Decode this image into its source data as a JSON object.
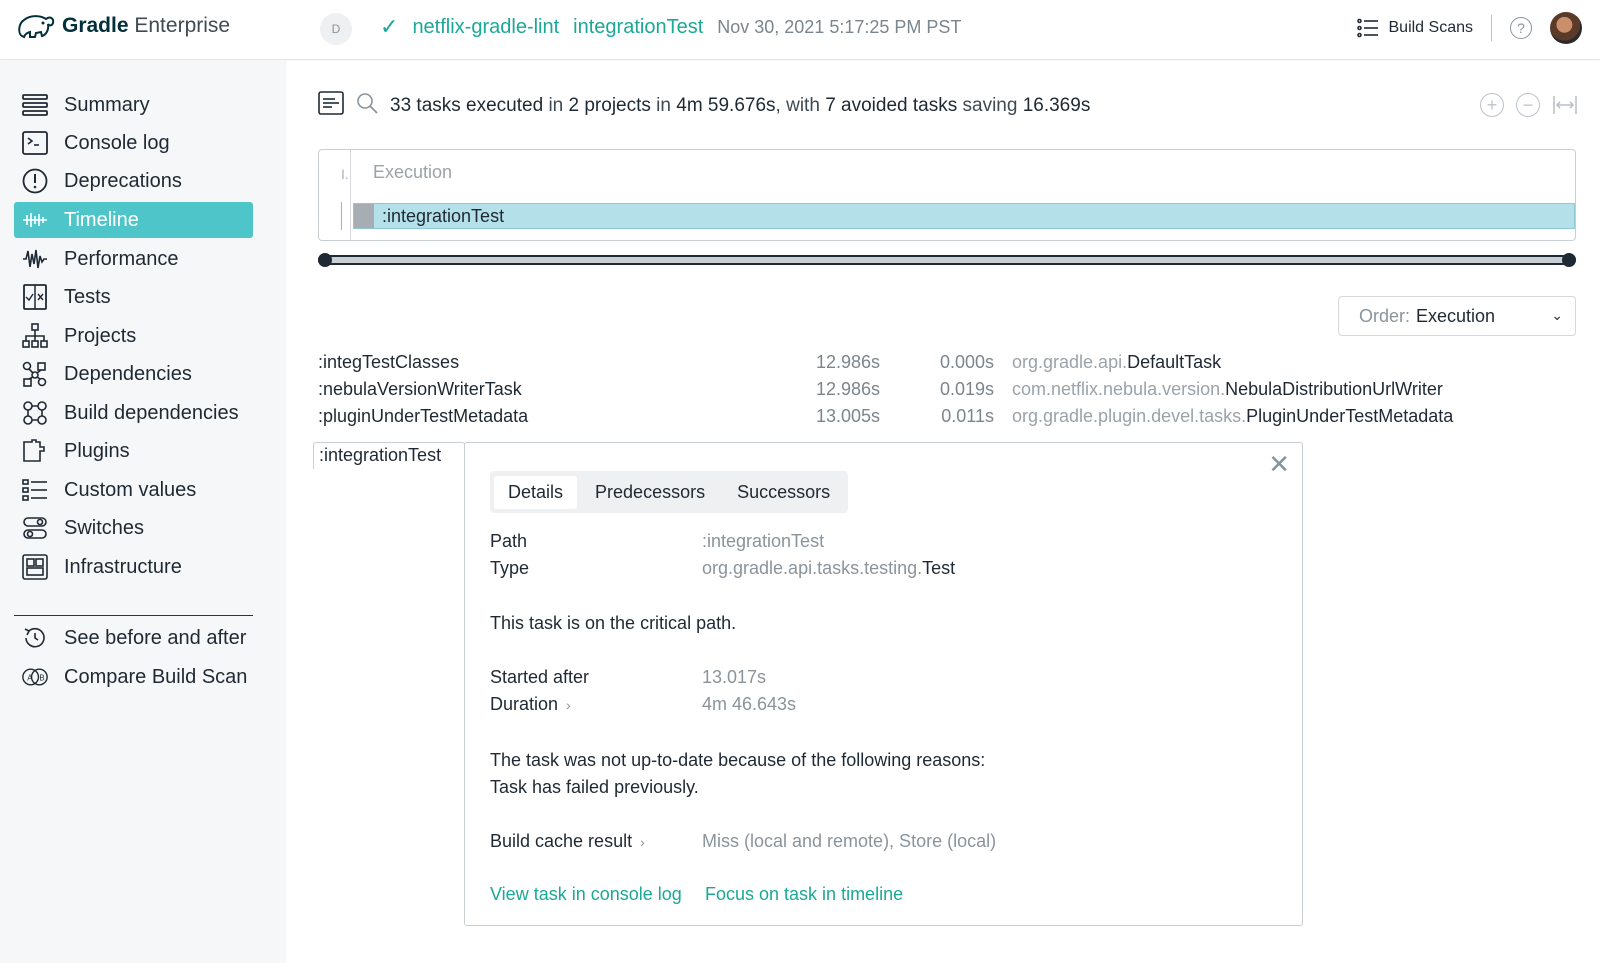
{
  "header": {
    "logo_bold": "Gradle",
    "logo_light": "Enterprise",
    "user_initial": "D",
    "project": "netflix-gradle-lint",
    "task": "integrationTest",
    "timestamp": "Nov 30, 2021 5:17:25 PM PST",
    "build_scans_label": "Build Scans",
    "help_label": "?"
  },
  "sidebar": {
    "items": [
      {
        "label": "Summary",
        "icon": "summary-icon"
      },
      {
        "label": "Console log",
        "icon": "console-icon"
      },
      {
        "label": "Deprecations",
        "icon": "deprecations-icon"
      },
      {
        "label": "Timeline",
        "icon": "timeline-icon",
        "active": true
      },
      {
        "label": "Performance",
        "icon": "performance-icon"
      },
      {
        "label": "Tests",
        "icon": "tests-icon"
      },
      {
        "label": "Projects",
        "icon": "projects-icon"
      },
      {
        "label": "Dependencies",
        "icon": "dependencies-icon"
      },
      {
        "label": "Build dependencies",
        "icon": "build-dependencies-icon"
      },
      {
        "label": "Plugins",
        "icon": "plugins-icon"
      },
      {
        "label": "Custom values",
        "icon": "custom-values-icon"
      },
      {
        "label": "Switches",
        "icon": "switches-icon"
      },
      {
        "label": "Infrastructure",
        "icon": "infrastructure-icon"
      }
    ],
    "secondary": [
      {
        "label": "See before and after",
        "icon": "history-icon"
      },
      {
        "label": "Compare Build Scan",
        "icon": "compare-icon"
      }
    ]
  },
  "summary": {
    "count_tasks": "33 tasks executed",
    "in1": "in",
    "projects": "2 projects",
    "in2": "in",
    "duration": "4m 59.676s",
    "with": ", with",
    "avoided": "7 avoided tasks",
    "saving": "saving",
    "saved": "16.369s"
  },
  "timeline": {
    "header_label": "Execution",
    "gutter_marker": "I.",
    "bar_label": ":integrationTest"
  },
  "order": {
    "label": "Order:",
    "value": "Execution"
  },
  "tasks": [
    {
      "name": ":integTestClasses",
      "duration": "12.986s",
      "start": "0.000s",
      "type_prefix": "org.gradle.api.",
      "type_name": "DefaultTask"
    },
    {
      "name": ":nebulaVersionWriterTask",
      "duration": "12.986s",
      "start": "0.019s",
      "type_prefix": "com.netflix.nebula.version.",
      "type_name": "NebulaDistributionUrlWriter"
    },
    {
      "name": ":pluginUnderTestMetadata",
      "duration": "13.005s",
      "start": "0.011s",
      "type_prefix": "org.gradle.plugin.devel.tasks.",
      "type_name": "PluginUnderTestMetadata"
    }
  ],
  "selected_task": ":integrationTest",
  "detail": {
    "tabs": [
      "Details",
      "Predecessors",
      "Successors"
    ],
    "path_label": "Path",
    "path_value": ":integrationTest",
    "type_label": "Type",
    "type_prefix": "org.gradle.api.tasks.testing.",
    "type_name": "Test",
    "critical_path": "This task is on the critical path.",
    "started_after_label": "Started after",
    "started_after_value": "13.017s",
    "duration_label": "Duration",
    "duration_value": "4m 46.643s",
    "reason_line1": "The task was not up-to-date because of the following reasons:",
    "reason_line2": "Task has failed previously.",
    "cache_label": "Build cache result",
    "cache_value": "Miss (local and remote), Store (local)",
    "link_console": "View task in console log",
    "link_focus": "Focus on task in timeline",
    "close_glyph": "✕"
  }
}
